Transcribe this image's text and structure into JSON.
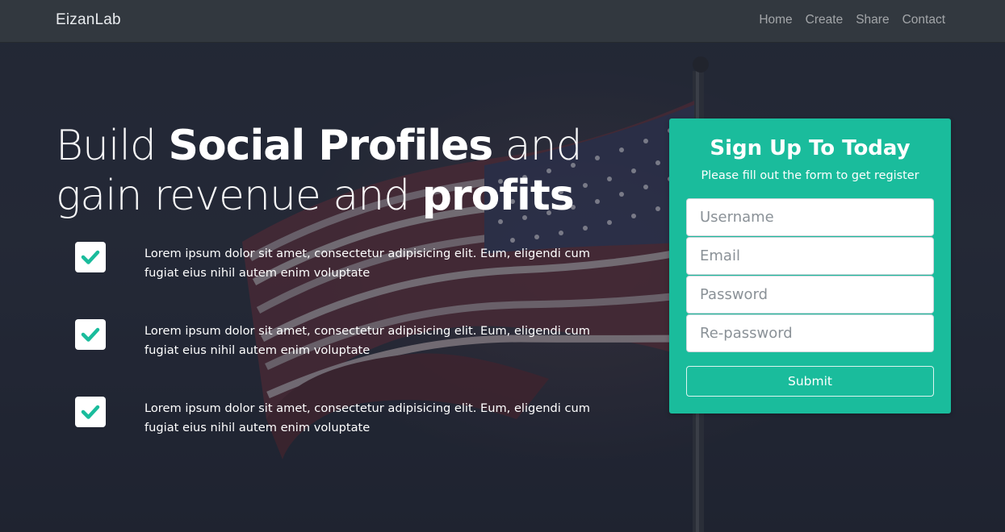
{
  "nav": {
    "brand": "EizanLab",
    "links": [
      "Home",
      "Create",
      "Share",
      "Contact"
    ]
  },
  "hero": {
    "headline_parts": [
      "Build ",
      "Social Profiles",
      " and gain revenue and ",
      "profits"
    ],
    "features": [
      "Lorem ipsum dolor sit amet, consectetur adipisicing elit. Eum, eligendi cum fugiat eius nihil autem enim voluptate",
      "Lorem ipsum dolor sit amet, consectetur adipisicing elit. Eum, eligendi cum fugiat eius nihil autem enim voluptate",
      "Lorem ipsum dolor sit amet, consectetur adipisicing elit. Eum, eligendi cum fugiat eius nihil autem enim voluptate"
    ]
  },
  "signup": {
    "title": "Sign Up To Today",
    "subtitle": "Please fill out the form to get register",
    "username_placeholder": "Username",
    "email_placeholder": "Email",
    "password_placeholder": "Password",
    "repassword_placeholder": "Re-password",
    "submit_label": "Submit"
  },
  "colors": {
    "accent": "#1abc9c",
    "navbar": "#343a40",
    "background": "#272c3b"
  },
  "icons": {
    "feature_check": "check-icon"
  }
}
